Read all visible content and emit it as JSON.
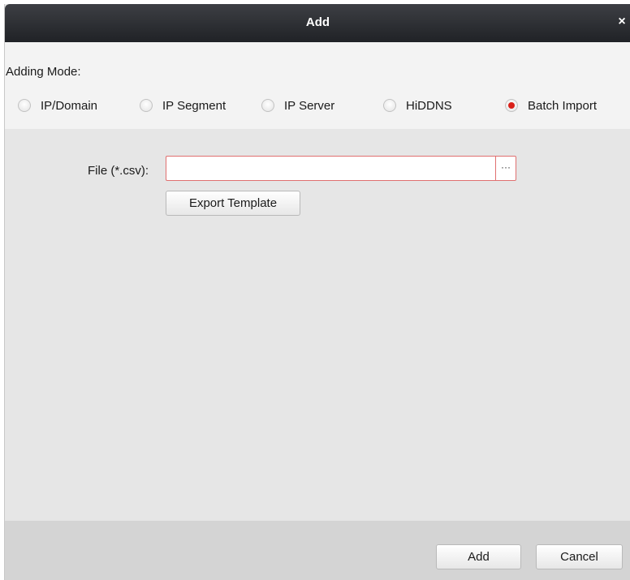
{
  "dialog": {
    "title": "Add",
    "close_glyph": "×"
  },
  "mode": {
    "label": "Adding Mode:",
    "options": [
      {
        "label": "IP/Domain",
        "checked": false
      },
      {
        "label": "IP Segment",
        "checked": false
      },
      {
        "label": "IP Server",
        "checked": false
      },
      {
        "label": "HiDDNS",
        "checked": false
      },
      {
        "label": "Batch Import",
        "checked": true
      }
    ]
  },
  "file": {
    "label": "File (*.csv):",
    "value": "",
    "placeholder": "",
    "browse_glyph": "···"
  },
  "export_template_label": "Export Template",
  "footer": {
    "add_label": "Add",
    "cancel_label": "Cancel"
  },
  "colors": {
    "titlebar": "#2c2e33",
    "radio_selected": "#d9201a",
    "input_border_error": "#e07070",
    "body": "#e6e6e6",
    "mode_panel": "#f3f3f3",
    "footer": "#d4d4d4"
  },
  "icons": {
    "close": "close-icon",
    "browse": "ellipsis-icon"
  }
}
